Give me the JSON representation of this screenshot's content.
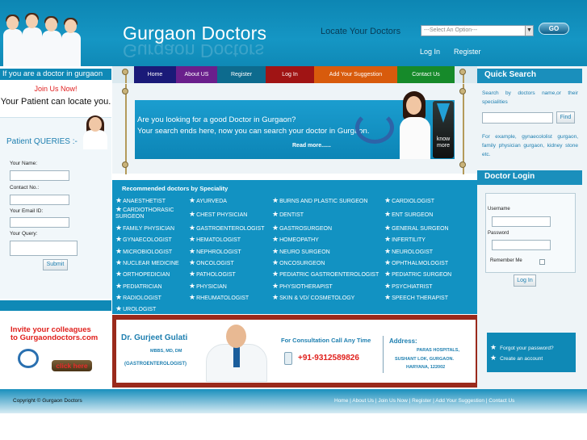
{
  "header": {
    "brand": "Gurgaon Doctors",
    "locate_label": "Locate Your Doctors",
    "select_placeholder": "---Select An Option---",
    "go_label": "GO",
    "login_link": "Log In",
    "register_link": "Register"
  },
  "left": {
    "doctor_banner": "If you are a doctor in gurgaon",
    "join_text": "Join Us Now!",
    "locate_text": "Your Patient can locate you.",
    "queries_title": "Patient QUERIES :-",
    "name_label": "Your Name:",
    "contact_label": "Contact No.:",
    "email_label": "Your Email ID:",
    "query_label": "Your Query:",
    "submit_label": "Submit",
    "invite_line1": "Invite your colleagues",
    "invite_line2": "to Gurgaondoctors.com",
    "click_here": "click here"
  },
  "nav": {
    "items": [
      {
        "label": "Home",
        "color": "#1a1a78"
      },
      {
        "label": "About US",
        "color": "#6a1f8c"
      },
      {
        "label": "Register",
        "color": "#0d6b8e"
      },
      {
        "label": "Log In",
        "color": "#a01414"
      },
      {
        "label": "Add Your Suggestion",
        "color": "#d85b0c"
      },
      {
        "label": "Contact Us",
        "color": "#168a2a"
      }
    ]
  },
  "banner": {
    "line1": "Are you looking for a good Doctor in Gurgaon?",
    "line2": "Your search ends here, now you can search your doctor in Gurgaon.",
    "read_more": "Read more......",
    "know_more": "know more"
  },
  "specialities": {
    "title": "Recommended doctors by Speciality",
    "col1": [
      "ANAESTHETIST",
      "CARDIOTHORASIC SURGEON",
      "FAMILY PHYSICIAN",
      "GYNAECOLOGIST",
      "MICROBIOLOGIST",
      "NUCLEAR MEDICINE",
      "ORTHOPEDICIAN",
      "PEDIATRICIAN",
      "RADIOLOGIST",
      "UROLOGIST"
    ],
    "col2": [
      "AYURVEDA",
      "CHEST PHYSICIAN",
      "GASTROENTEROLOGIST",
      "HEMATOLOGIST",
      "NEPHROLOGIST",
      "ONCOLOGIST",
      "PATHOLOGIST",
      "PHYSICIAN",
      "RHEUMATOLOGIST"
    ],
    "col3": [
      "BURNS AND PLASTIC SURGEON",
      "DENTIST",
      "GASTROSURGEON",
      "HOMEOPATHY",
      "NEURO SURGEON",
      "ONCOSURGEON",
      "PEDIATRIC GASTROENTEROLOGIST",
      "PHYSIOTHERAPIST",
      "SKIN  & VD/ COSMETOLOGY"
    ],
    "col4": [
      "CARDIOLOGIST",
      "ENT SURGEON",
      "GENERAL SURGEON",
      "INFERTILITY",
      "NEUROLOGIST",
      "OPHTHALMOLOGIST",
      "PEDIATRIC SURGEON",
      "PSYCHIATRIST",
      "SPEECH THERAPIST"
    ]
  },
  "promo": {
    "name": "Dr. Gurjeet Gulati",
    "qualification": "MBBS, MD, DM",
    "speciality": "(GASTROENTEROLOGIST)",
    "consult_label": "For Consultation Call Any Time",
    "phone": "+91-9312589826",
    "address_title": "Address:",
    "address_lines": [
      "PARAS HOSPITALS,",
      "SUSHANT LOK, GURGAON.",
      "HARYANA, 122002"
    ]
  },
  "right": {
    "quick_search_title": "Quick Search",
    "search_hint": "Search by doctors name,or their specialities",
    "find_label": "Find",
    "example_text": "For example, gynaecololist gurgaon, family physician gurgaon, kidney stone etc.",
    "doctor_login_title": "Doctor Login",
    "username_label": "Username",
    "password_label": "Password",
    "remember_label": "Remember Me",
    "login_button": "Log In",
    "forgot_password": "Forgot your password?",
    "create_account": "Create an account"
  },
  "footer": {
    "copyright": "Copyright © Gurgaon Doctors",
    "links": "Home | About Us | Join Us Now | Register | Add Your Suggestion | Contact Us"
  }
}
